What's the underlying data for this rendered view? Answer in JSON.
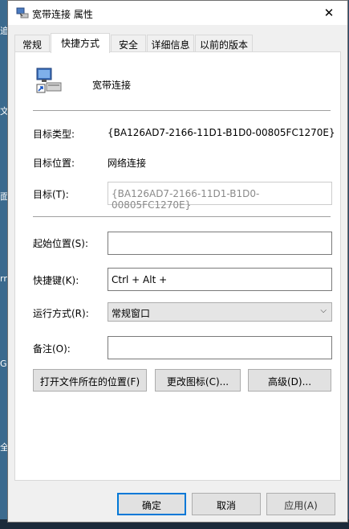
{
  "window": {
    "title": "宽带连接 属性",
    "close_label": "✕"
  },
  "tabs": [
    {
      "label": "常规"
    },
    {
      "label": "快捷方式",
      "active": true
    },
    {
      "label": "安全"
    },
    {
      "label": "详细信息"
    },
    {
      "label": "以前的版本"
    }
  ],
  "shortcut": {
    "name": "宽带连接",
    "target_type_label": "目标类型:",
    "target_type_value": "{BA126AD7-2166-11D1-B1D0-00805FC1270E}",
    "target_location_label": "目标位置:",
    "target_location_value": "网络连接",
    "target_label": "目标(T):",
    "target_value": "{BA126AD7-2166-11D1-B1D0-00805FC1270E}",
    "start_in_label": "起始位置(S):",
    "start_in_value": "",
    "hotkey_label": "快捷键(K):",
    "hotkey_value": "Ctrl + Alt +",
    "run_label": "运行方式(R):",
    "run_value": "常规窗口",
    "comment_label": "备注(O):",
    "comment_value": "",
    "open_location_button": "打开文件所在的位置(F)",
    "change_icon_button": "更改图标(C)...",
    "advanced_button": "高级(D)..."
  },
  "footer": {
    "ok_button": "确定",
    "cancel_button": "取消",
    "apply_button": "应用(A)"
  },
  "desktop_fragments": [
    "追",
    "文",
    "面",
    "rn",
    "G",
    "全"
  ],
  "colors": {
    "accent": "#0078d7",
    "panel": "#ffffff",
    "dialog": "#f0f0f0"
  }
}
